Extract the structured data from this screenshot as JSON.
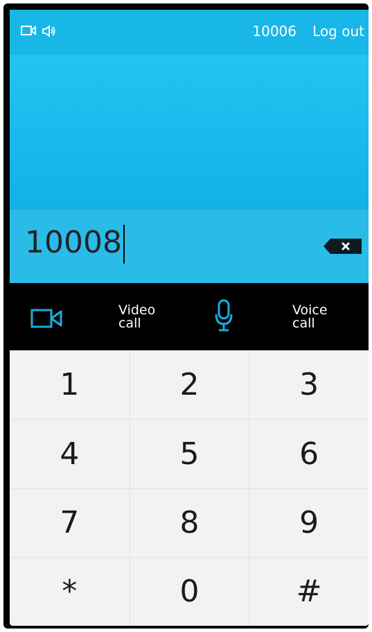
{
  "header": {
    "icons": [
      "video-camera-icon",
      "speaker-icon"
    ],
    "user_id": "10006",
    "logout_label": "Log out"
  },
  "dial_entry": {
    "value": "10008"
  },
  "call_actions": {
    "video_call_line1": "Video",
    "video_call_line2": "call",
    "voice_call_line1": "Voice",
    "voice_call_line2": "call"
  },
  "keypad": {
    "keys": [
      "1",
      "2",
      "3",
      "4",
      "5",
      "6",
      "7",
      "8",
      "9",
      "*",
      "0",
      "#"
    ]
  },
  "colors": {
    "accent": "#19b7e8",
    "call_bar": "#000000",
    "keypad_bg": "#f2f2f2"
  }
}
